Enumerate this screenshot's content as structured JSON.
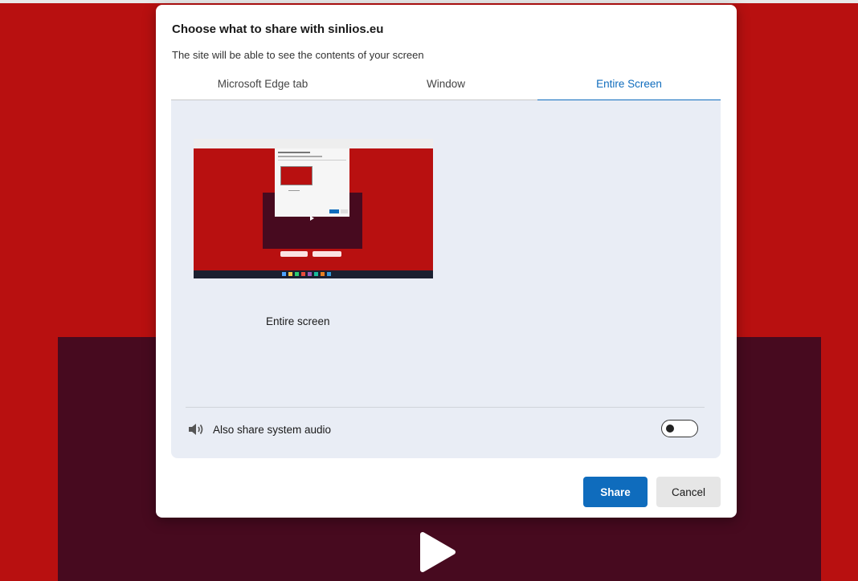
{
  "dialog": {
    "title": "Choose what to share with sinlios.eu",
    "subtitle": "The site will be able to see the contents of your screen"
  },
  "tabs": [
    {
      "label": "Microsoft Edge tab",
      "active": false
    },
    {
      "label": "Window",
      "active": false
    },
    {
      "label": "Entire Screen",
      "active": true
    }
  ],
  "sources": [
    {
      "label": "Entire screen",
      "icon": "screen-thumbnail"
    }
  ],
  "audio": {
    "label": "Also share system audio",
    "icon": "speaker-icon",
    "enabled": false
  },
  "buttons": {
    "share": "Share",
    "cancel": "Cancel"
  },
  "colors": {
    "accent": "#0f6cbd",
    "page_background": "#b81010",
    "video_background": "#470a1f",
    "content_background": "#e9edf5"
  }
}
